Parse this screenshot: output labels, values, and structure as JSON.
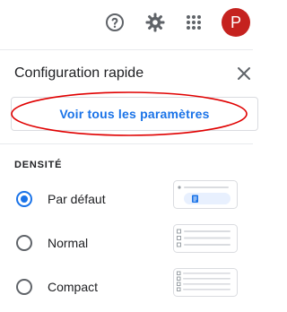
{
  "topbar": {
    "help_icon": "help-circle-icon",
    "settings_icon": "gear-icon",
    "apps_icon": "apps-grid-icon",
    "avatar_letter": "P",
    "avatar_color": "#c5221f"
  },
  "quick_settings": {
    "title": "Configuration rapide",
    "see_all_label": "Voir tous les paramètres",
    "density_label": "DENSITÉ",
    "density_options": [
      {
        "label": "Par défaut",
        "selected": true
      },
      {
        "label": "Normal",
        "selected": false
      },
      {
        "label": "Compact",
        "selected": false
      }
    ]
  },
  "colors": {
    "accent": "#1a73e8",
    "highlight_ellipse": "#e00000"
  }
}
